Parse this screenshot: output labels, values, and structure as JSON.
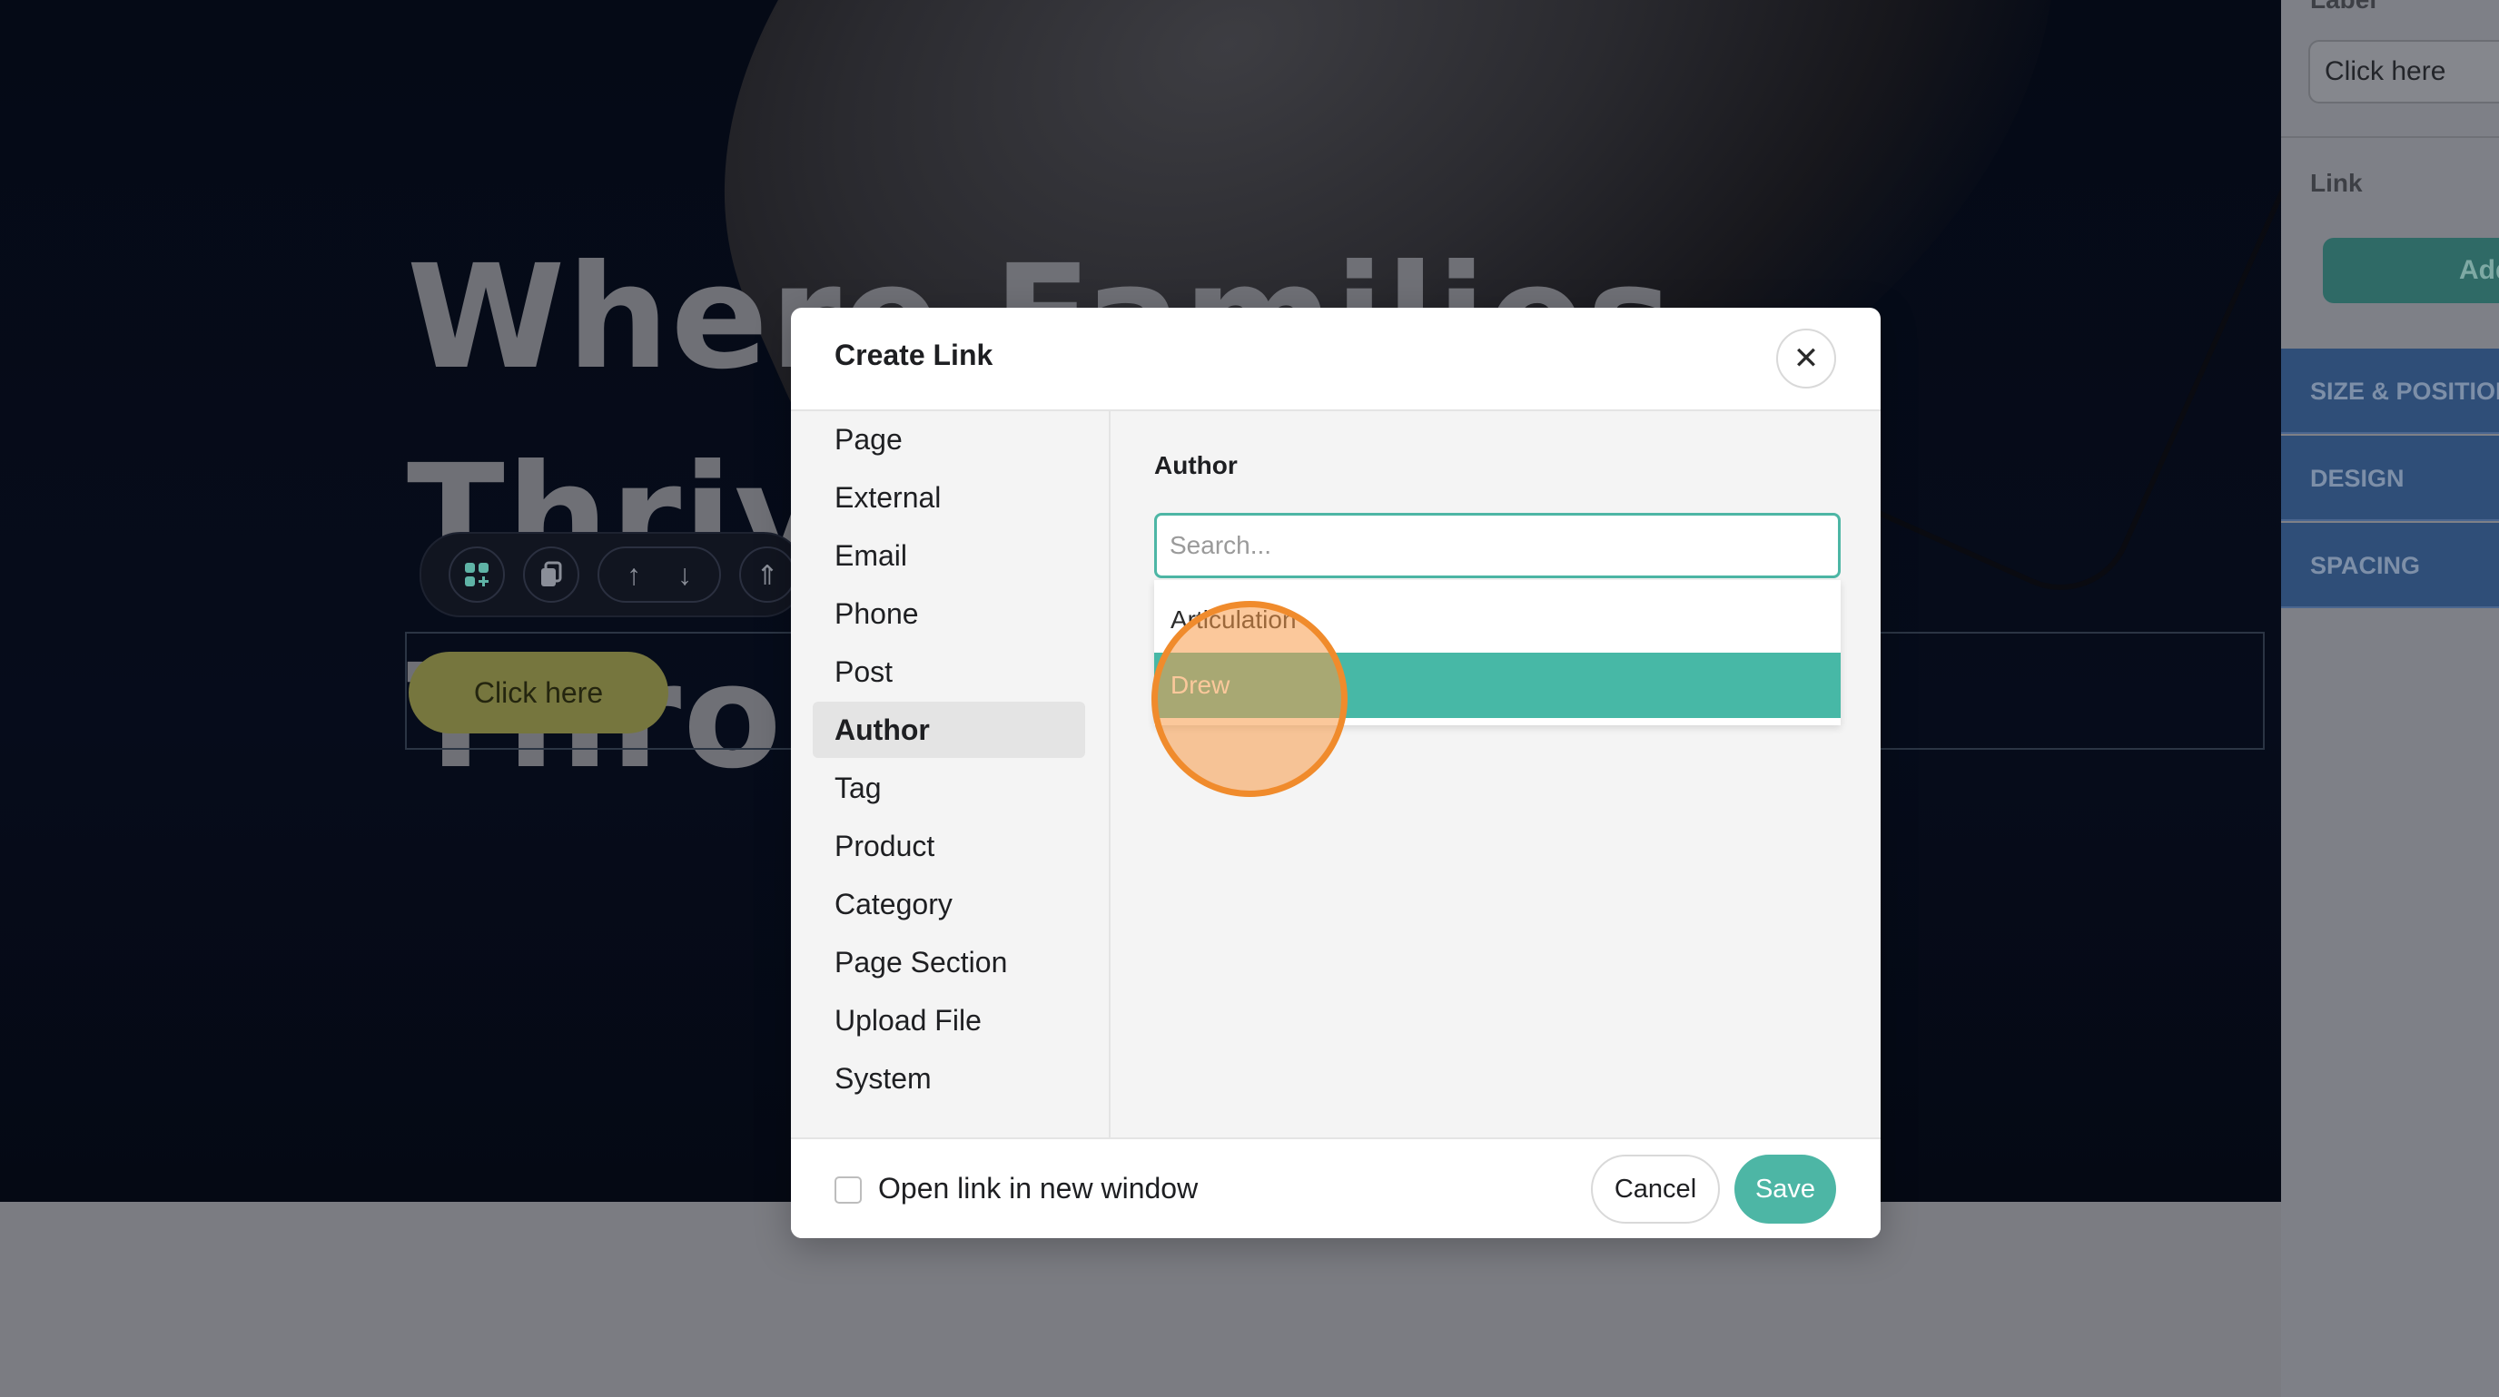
{
  "hero": {
    "title_line1": "Where Families Thrive",
    "title_line2": "Throu",
    "button_label": "Click here"
  },
  "toolbar": {
    "icons": [
      "add-element-icon",
      "duplicate-icon",
      "move-up-icon",
      "move-down-icon",
      "move-to-top-icon"
    ]
  },
  "right_panel": {
    "label_heading": "Label",
    "label_value": "Click here",
    "link_heading": "Link",
    "add_button": "Add",
    "sections": [
      "SIZE & POSITION",
      "DESIGN",
      "SPACING"
    ]
  },
  "modal": {
    "title": "Create Link",
    "close_icon": "close-icon",
    "nav_items": [
      "Page",
      "External",
      "Email",
      "Phone",
      "Post",
      "Author",
      "Tag",
      "Product",
      "Category",
      "Page Section",
      "Upload File",
      "System"
    ],
    "active_nav": "Author",
    "field_label": "Author",
    "search_placeholder": "Search...",
    "search_value": "",
    "options": [
      "Articulation",
      "Drew"
    ],
    "highlighted_option": "Drew",
    "new_window_label": "Open link in new window",
    "new_window_checked": false,
    "cancel_label": "Cancel",
    "save_label": "Save"
  },
  "colors": {
    "accent": "#4db6a5",
    "highlight_ring": "#f08b2c"
  }
}
